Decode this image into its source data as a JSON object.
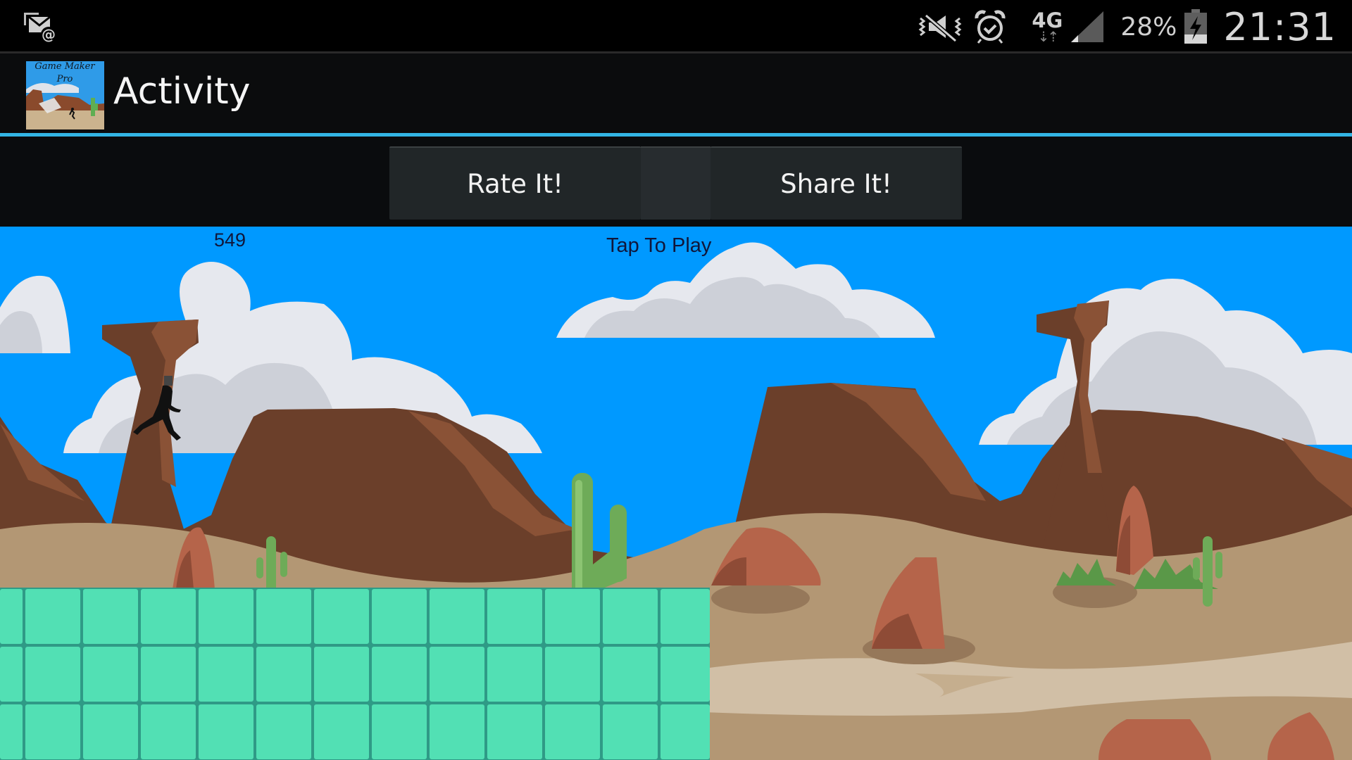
{
  "status_bar": {
    "notification_icon": "email-at-icon",
    "icons": [
      "vibrate-mute-icon",
      "alarm-icon",
      "network-4g-icon",
      "signal-strength-icon",
      "battery-charging-icon"
    ],
    "network_type": "4G",
    "network_activity": "⇣⇡",
    "battery_percent": "28%",
    "time": "21:31"
  },
  "action_bar": {
    "app_icon": {
      "line1": "Game Maker",
      "line2": "Pro"
    },
    "title": "Activity",
    "accent_color": "#33b5e5"
  },
  "buttons": {
    "rate": "Rate It!",
    "share": "Share It!"
  },
  "game": {
    "score": "549",
    "prompt": "Tap To Play",
    "sky_color": "#0099ff",
    "tile_color": "#52e0b4",
    "tile_columns_visible": 13,
    "tile_rows_visible": 3
  }
}
